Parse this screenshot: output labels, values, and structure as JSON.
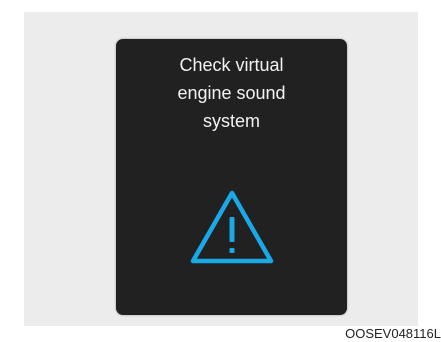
{
  "display": {
    "message_lines": [
      "Check virtual",
      "engine sound",
      "system"
    ],
    "icon": "warning-triangle-icon",
    "icon_color": "#1aa9e6",
    "background_color": "#222121"
  },
  "caption": "OOSEV048116L"
}
